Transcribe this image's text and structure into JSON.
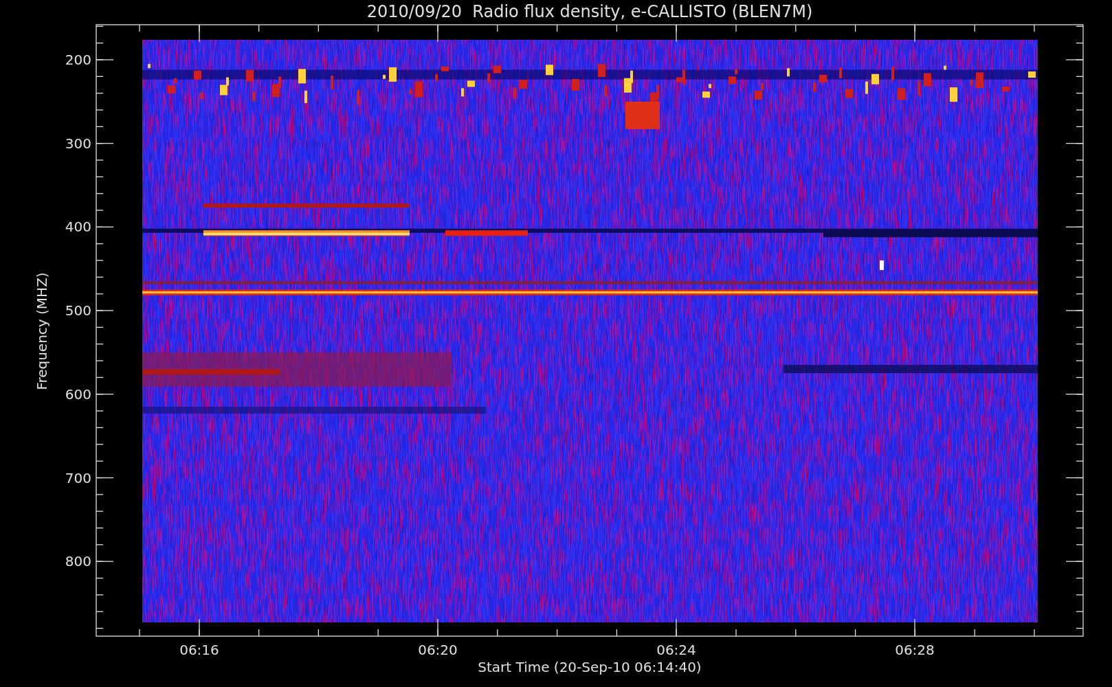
{
  "title": "2010/09/20  Radio flux density, e-CALLISTO (BLEN7M)",
  "y_axis": {
    "label": "Frequency (MHZ)",
    "ticks": [
      "200",
      "300",
      "400",
      "500",
      "600",
      "700",
      "800"
    ]
  },
  "x_axis": {
    "label": "Start Time (20-Sep-10 06:14:40)",
    "ticks": [
      "06:16",
      "06:20",
      "06:24",
      "06:28"
    ]
  }
}
